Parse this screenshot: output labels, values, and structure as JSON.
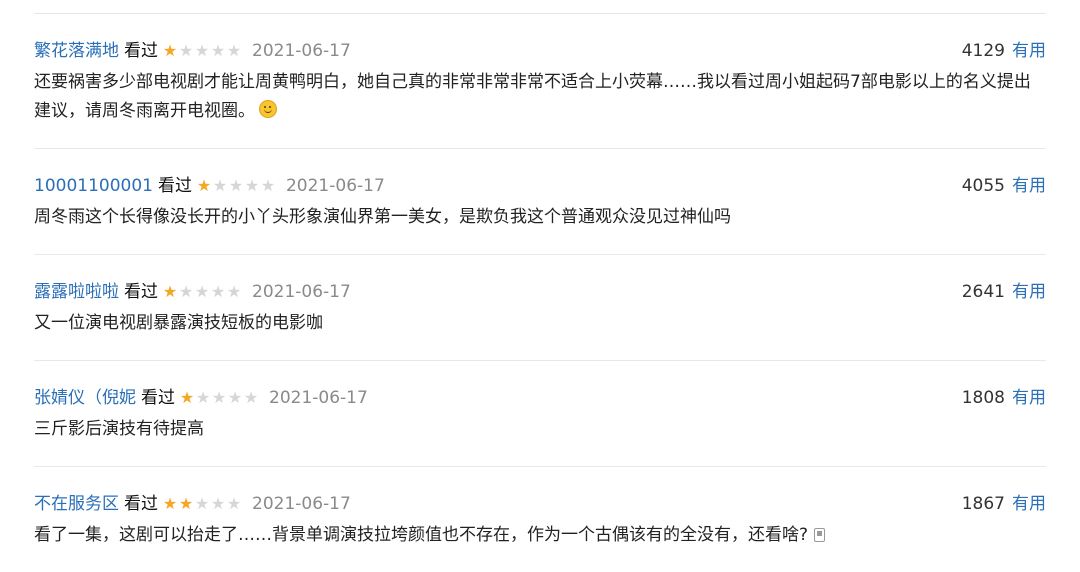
{
  "comments": [
    {
      "user": "繁花落满地",
      "status": "看过",
      "stars": 1,
      "date": "2021-06-17",
      "votes": "4129",
      "useful_label": "有用",
      "text": "还要祸害多少部电视剧才能让周黄鸭明白，她自己真的非常非常非常不适合上小荧幕……我以看过周小姐起码7部电影以上的名义提出建议，请周冬雨离开电视圈。",
      "trailing_icon": "smile-emoji-icon"
    },
    {
      "user": "10001100001",
      "status": "看过",
      "stars": 1,
      "date": "2021-06-17",
      "votes": "4055",
      "useful_label": "有用",
      "text": "周冬雨这个长得像没长开的小丫头形象演仙界第一美女，是欺负我这个普通观众没见过神仙吗"
    },
    {
      "user": "露露啦啦啦",
      "status": "看过",
      "stars": 1,
      "date": "2021-06-17",
      "votes": "2641",
      "useful_label": "有用",
      "text": "又一位演电视剧暴露演技短板的电影咖"
    },
    {
      "user": "张婧仪（倪妮",
      "status": "看过",
      "stars": 1,
      "date": "2021-06-17",
      "votes": "1808",
      "useful_label": "有用",
      "text": "三斤影后演技有待提高"
    },
    {
      "user": "不在服务区",
      "status": "看过",
      "stars": 2,
      "date": "2021-06-17",
      "votes": "1867",
      "useful_label": "有用",
      "text": "看了一集，这剧可以抬走了……背景单调演技拉垮颜值也不存在，作为一个古偶该有的全没有，还看啥?",
      "trailing_icon": "report-icon"
    }
  ],
  "colors": {
    "username": "#2a6fb8",
    "star_on": "#f5a623",
    "star_off": "#d6d6d6",
    "date": "#8a8a8a"
  }
}
